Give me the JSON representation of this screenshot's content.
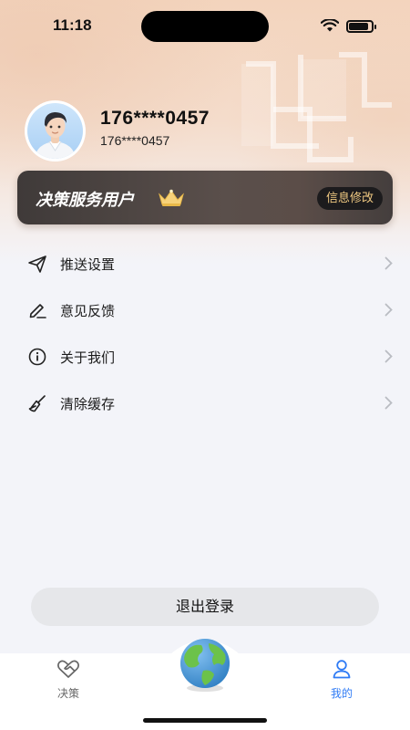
{
  "status_bar": {
    "time": "11:18"
  },
  "profile": {
    "phone": "176****0457",
    "phone_sub": "176****0457"
  },
  "vip_card": {
    "title": "决策服务用户",
    "edit_label": "信息修改",
    "icon": "crown-icon"
  },
  "menu": {
    "items": [
      {
        "label": "推送设置",
        "icon": "paper-plane-icon"
      },
      {
        "label": "意见反馈",
        "icon": "pen-icon"
      },
      {
        "label": "关于我们",
        "icon": "info-icon"
      },
      {
        "label": "清除缓存",
        "icon": "broom-icon"
      }
    ]
  },
  "logout": {
    "label": "退出登录"
  },
  "tab_bar": {
    "tabs": [
      {
        "label": "决策",
        "icon": "handshake-icon",
        "active": false
      },
      {
        "label": "我的",
        "icon": "person-icon",
        "active": true
      }
    ],
    "center_icon": "globe-icon"
  },
  "colors": {
    "accent": "#2f7bf5",
    "vip_gold": "#f0c982",
    "logout_bg": "#e6e7ea"
  }
}
